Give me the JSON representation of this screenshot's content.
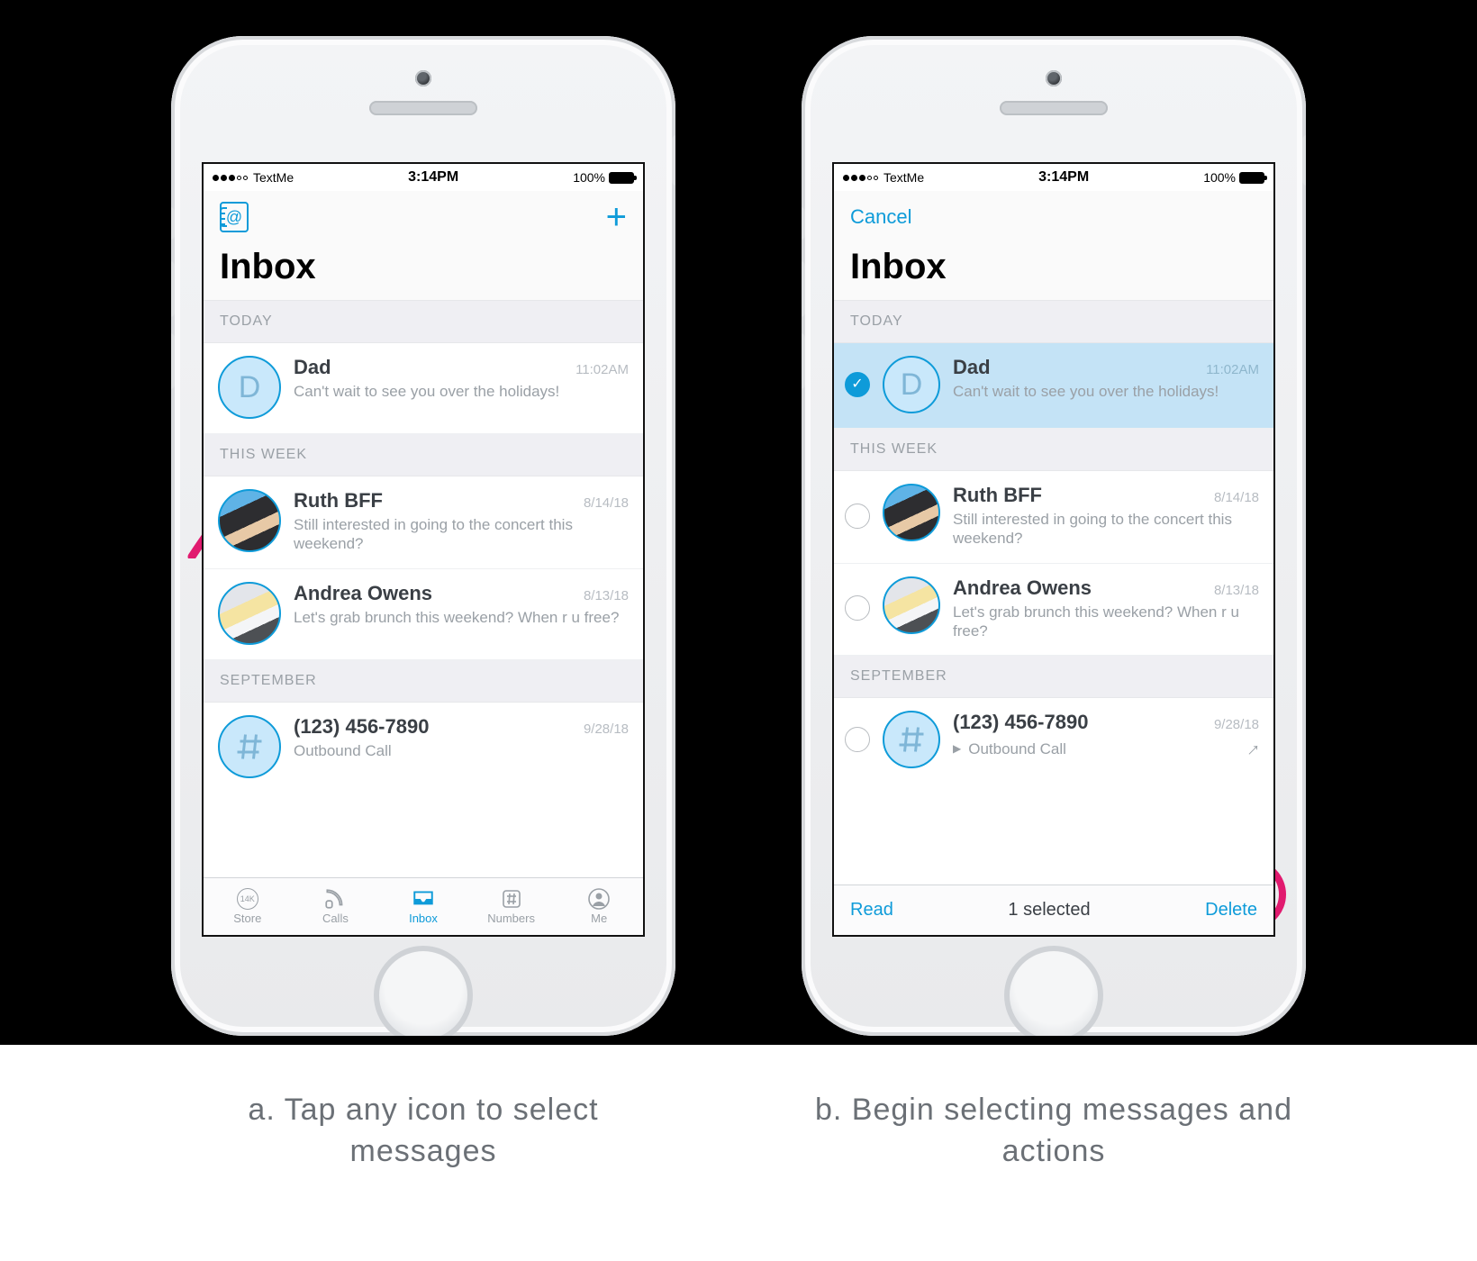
{
  "status": {
    "carrier": "TextMe",
    "time": "3:14PM",
    "battery_pct": "100%"
  },
  "accent": "#0e9bd9",
  "highlight": "#e11a6f",
  "nav": {
    "title": "Inbox",
    "compose_glyph": "+",
    "cancel_label": "Cancel",
    "contacts_glyph": "@"
  },
  "sections": {
    "today": "TODAY",
    "this_week": "THIS WEEK",
    "september": "SEPTEMBER"
  },
  "rows": {
    "dad": {
      "name": "Dad",
      "initial": "D",
      "time": "11:02AM",
      "preview": "Can't wait to see you over the holidays!"
    },
    "ruth": {
      "name": "Ruth BFF",
      "time": "8/14/18",
      "preview": "Still interested in going to the concert this weekend?"
    },
    "andrea": {
      "name": "Andrea Owens",
      "time": "8/13/18",
      "preview": "Let's grab brunch this weekend? When r u free?"
    },
    "call": {
      "name": "(123) 456-7890",
      "time": "9/28/18",
      "preview": "Outbound Call"
    }
  },
  "tabs": {
    "store": {
      "label": "Store",
      "badge": "14K"
    },
    "calls": {
      "label": "Calls"
    },
    "inbox": {
      "label": "Inbox"
    },
    "numbers": {
      "label": "Numbers"
    },
    "me": {
      "label": "Me"
    }
  },
  "editbar": {
    "read": "Read",
    "delete": "Delete",
    "count": "1 selected"
  },
  "captions": {
    "a": "a. Tap any icon to select messages",
    "b": "b. Begin selecting messages and actions"
  }
}
